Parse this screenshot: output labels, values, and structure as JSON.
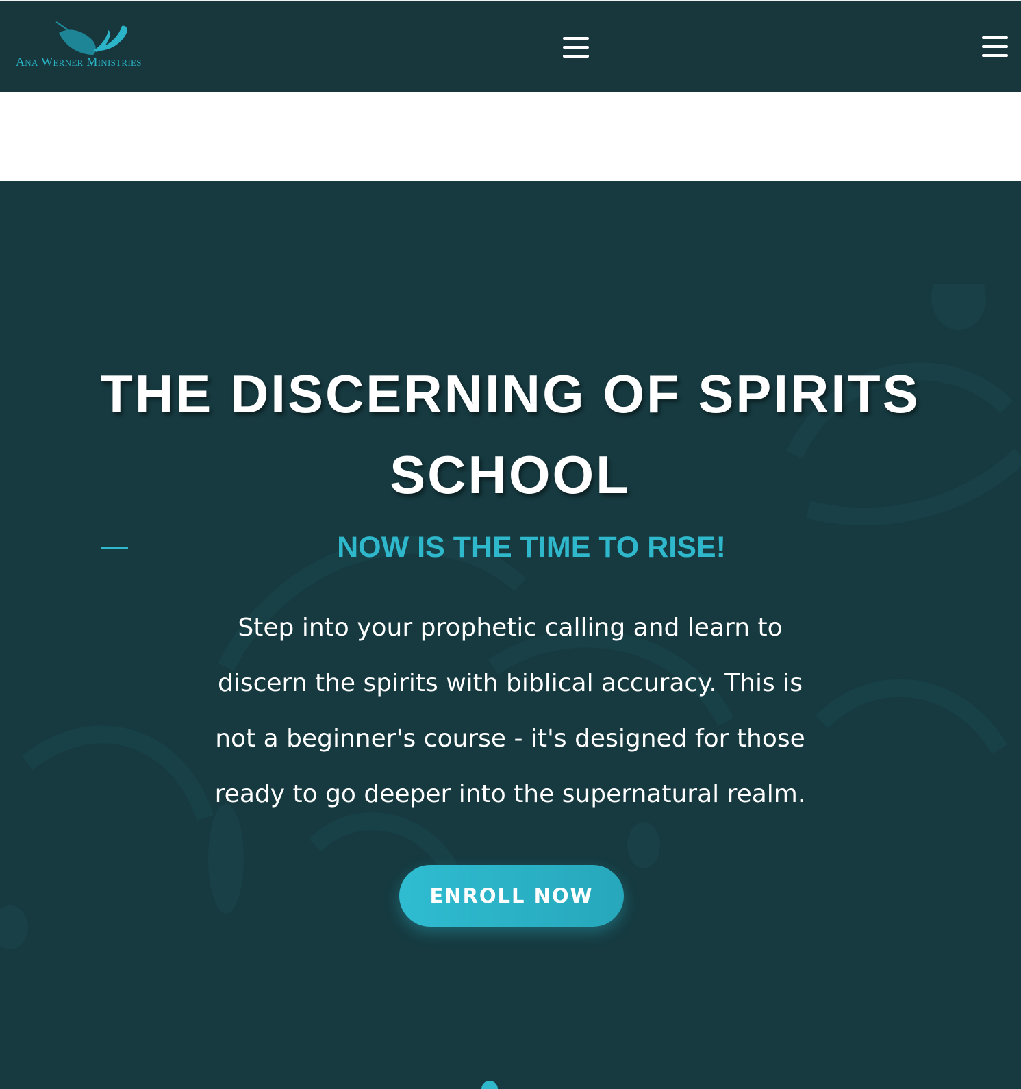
{
  "site": {
    "logo_text": "Ana Werner Ministries",
    "logo_icon": "feather-icon"
  },
  "header": {
    "menu_center_icon": "hamburger-menu-icon",
    "menu_right_icon": "hamburger-menu-icon"
  },
  "hero": {
    "title": "THE DISCERNING OF SPIRITS SCHOOL",
    "subtitle": "NOW IS THE TIME TO RISE!",
    "description": "Step into your prophetic calling and learn to discern the spirits with biblical accuracy. This is not a beginner's course - it's designed for those ready to go deeper into the supernatural realm.",
    "cta_label": "ENROLL NOW"
  },
  "colors": {
    "header_bg": "#17373d",
    "hero_bg": "#163a40",
    "accent": "#2fb8cc",
    "text": "#ffffff"
  }
}
